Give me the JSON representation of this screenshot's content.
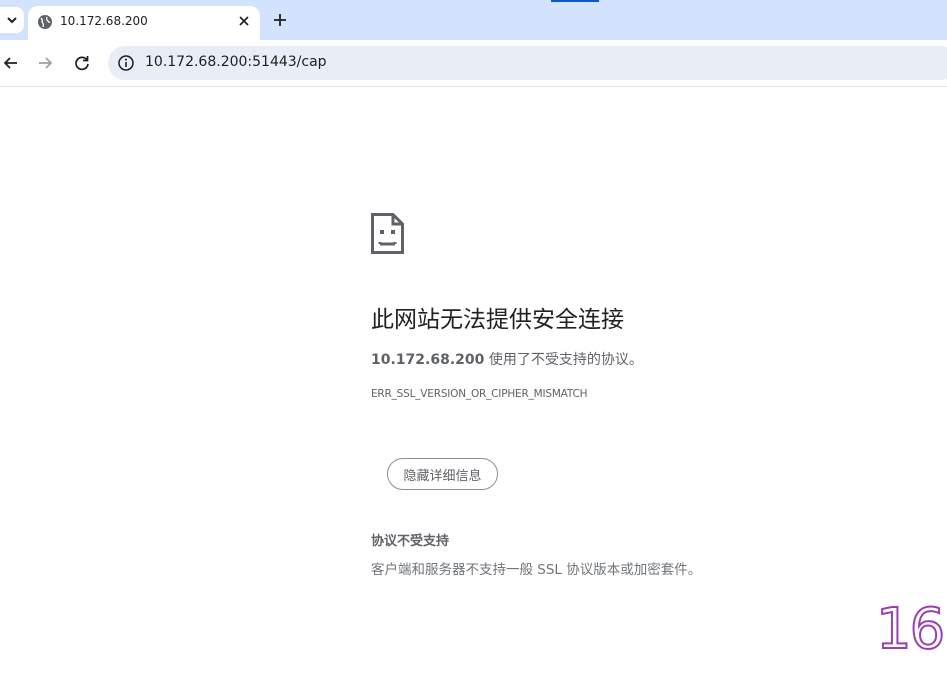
{
  "tab": {
    "favicon": "globe-icon",
    "title": "10.172.68.200",
    "close_icon": "close-icon"
  },
  "toolbar": {
    "back_icon": "back-arrow-icon",
    "forward_icon": "forward-arrow-icon",
    "reload_icon": "reload-icon",
    "site_info_icon": "info-icon",
    "url": "10.172.68.200:51443/cap"
  },
  "error": {
    "icon": "sad-page-icon",
    "heading": "此网站无法提供安全连接",
    "host": "10.172.68.200",
    "description_suffix": " 使用了不受支持的协议。",
    "code": "ERR_SSL_VERSION_OR_CIPHER_MISMATCH",
    "details_button": "隐藏详细信息",
    "detail_title": "协议不受支持",
    "detail_text": "客户端和服务器不支持一般 SSL 协议版本或加密套件。"
  },
  "overlay": {
    "number": "16"
  },
  "colors": {
    "tabstrip_bg": "#d3e3fd",
    "omnibox_bg": "#e9eef6",
    "accent": "#0b57d0",
    "text_secondary": "#5f6368",
    "overlay_outline": "#9b3fb0"
  }
}
